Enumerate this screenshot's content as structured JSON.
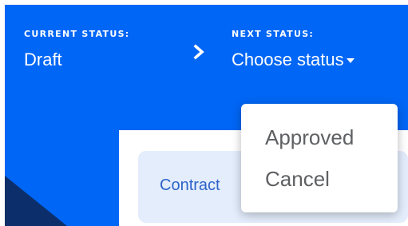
{
  "current_status": {
    "label": "CURRENT STATUS:",
    "value": "Draft"
  },
  "transition_icon": "chevron-right-icon",
  "next_status": {
    "label": "NEXT STATUS:",
    "value": "Choose status",
    "icon": "caret-down-icon"
  },
  "content": {
    "link_text": "Contract"
  },
  "dropdown": {
    "items": [
      {
        "label": "Approved"
      },
      {
        "label": "Cancel"
      }
    ]
  },
  "colors": {
    "header_background": "#0066f5",
    "corner_accent": "#0c2f6b",
    "card_background": "#e3edfc",
    "link_text": "#2e63c9",
    "menu_text": "#5f6063"
  }
}
